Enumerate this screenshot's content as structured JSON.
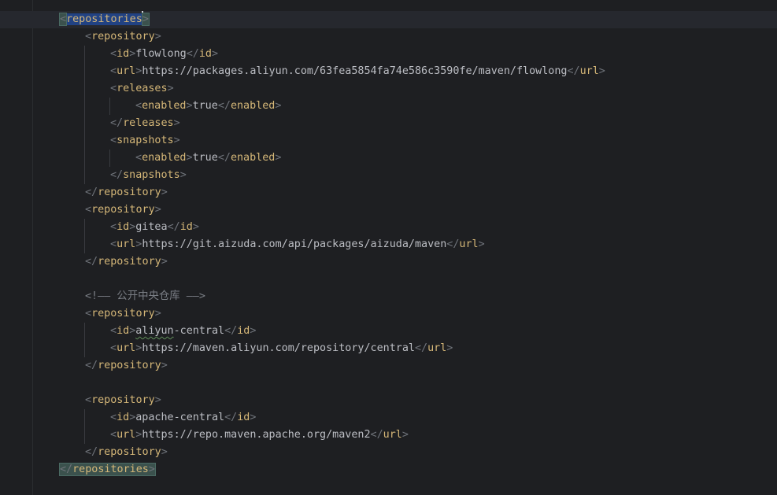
{
  "editor": {
    "repositories_tag": "repositories",
    "repository_tag": "repository",
    "id_tag": "id",
    "url_tag": "url",
    "releases_tag": "releases",
    "snapshots_tag": "snapshots",
    "enabled_tag": "enabled",
    "enabled_value": "true",
    "repositories": [
      {
        "id": "flowlong",
        "url": "https://packages.aliyun.com/63fea5854fa74e586c3590fe/maven/flowlong"
      },
      {
        "id": "gitea",
        "url": "https://git.aizuda.com/api/packages/aizuda/maven"
      },
      {
        "id_prefix": "aliyun",
        "id_suffix": "-central",
        "url": "https://maven.aliyun.com/repository/central"
      },
      {
        "id": "apache-central",
        "url": "https://repo.maven.apache.org/maven2"
      }
    ],
    "comment": "<!—— 公开中央仓库 ——>"
  },
  "colors": {
    "background": "#1e1f22",
    "tag": "#d5b778",
    "bracket": "#6f737a",
    "text": "#bcbec4",
    "comment": "#7a7e85",
    "selection": "#214283",
    "brace_match": "#3b514d",
    "current_line": "#26282e"
  }
}
